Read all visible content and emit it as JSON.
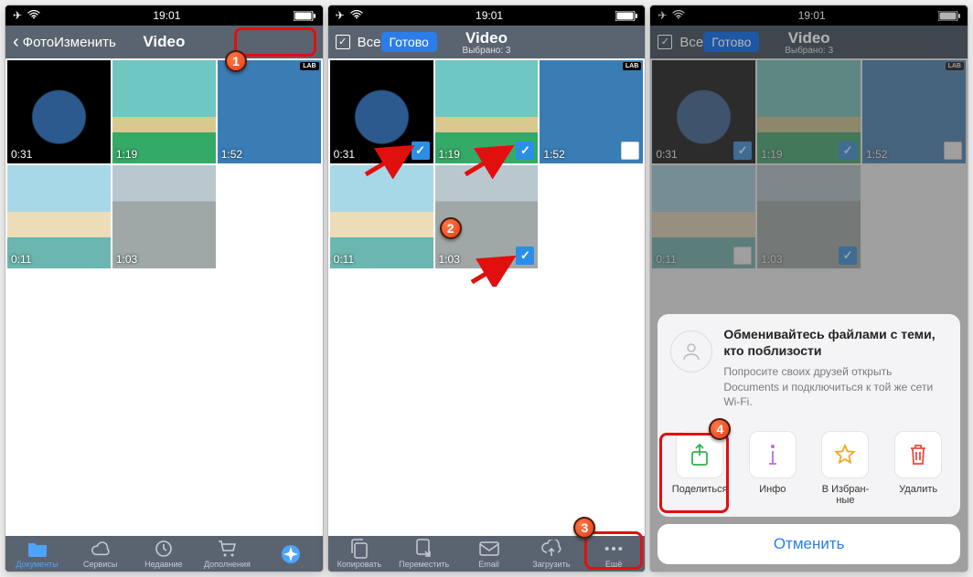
{
  "status": {
    "time": "19:01"
  },
  "screen1": {
    "back_label": "Фото",
    "title": "Video",
    "edit_label": "Изменить",
    "thumbs": [
      {
        "dur": "0:31",
        "bg": "bg-earth"
      },
      {
        "dur": "1:19",
        "bg": "bg-island"
      },
      {
        "dur": "1:52",
        "bg": "bg-ship",
        "lab": "LAB"
      },
      {
        "dur": "0:11",
        "bg": "bg-beach"
      },
      {
        "dur": "1:03",
        "bg": "bg-city"
      }
    ],
    "tabs": [
      {
        "label": "Документы",
        "active": true
      },
      {
        "label": "Сервисы"
      },
      {
        "label": "Недавние"
      },
      {
        "label": "Дополнения"
      },
      {
        "label": ""
      }
    ]
  },
  "screen2": {
    "select_all": "Все",
    "title": "Video",
    "subtitle": "Выбрано: 3",
    "done_label": "Готово",
    "thumbs": [
      {
        "dur": "0:31",
        "bg": "bg-earth",
        "sel": true
      },
      {
        "dur": "1:19",
        "bg": "bg-island",
        "sel": true
      },
      {
        "dur": "1:52",
        "bg": "bg-ship",
        "sel": false,
        "lab": "LAB"
      },
      {
        "dur": "0:11",
        "bg": "bg-beach"
      },
      {
        "dur": "1:03",
        "bg": "bg-city",
        "sel": true
      }
    ],
    "tabs": [
      {
        "label": "Копировать"
      },
      {
        "label": "Переместить"
      },
      {
        "label": "Email"
      },
      {
        "label": "Загрузить"
      },
      {
        "label": "Ещё"
      }
    ]
  },
  "screen3": {
    "select_all": "Все",
    "title": "Video",
    "subtitle": "Выбрано: 3",
    "done_label": "Готово",
    "thumbs": [
      {
        "dur": "0:31",
        "bg": "bg-earth",
        "sel": true
      },
      {
        "dur": "1:19",
        "bg": "bg-island",
        "sel": true
      },
      {
        "dur": "1:52",
        "bg": "bg-ship",
        "sel": false,
        "lab": "LAB"
      },
      {
        "dur": "0:11",
        "bg": "bg-beach",
        "sel": false
      },
      {
        "dur": "1:03",
        "bg": "bg-city",
        "sel": true
      }
    ],
    "sheet": {
      "nearby_title": "Обменивайтесь файлами с теми, кто поблизости",
      "nearby_body": "Попросите своих друзей открыть Documents и подключиться к той же сети Wi-Fi.",
      "actions": [
        {
          "label": "Поделиться",
          "color": "#2fb24c"
        },
        {
          "label": "Инфо",
          "color": "#b56de0"
        },
        {
          "label": "В Избран-\nные",
          "color": "#f5a623"
        },
        {
          "label": "Удалить",
          "color": "#e9493f"
        }
      ],
      "cancel": "Отменить"
    }
  },
  "callouts": {
    "c1": "1",
    "c2": "2",
    "c3": "3",
    "c4": "4"
  }
}
